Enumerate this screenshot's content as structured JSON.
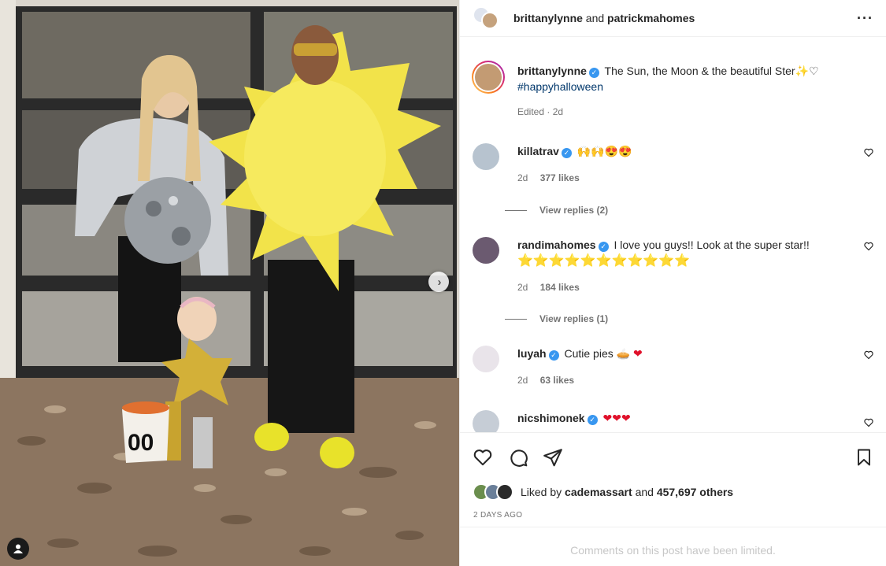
{
  "header": {
    "user1": "brittanylynne",
    "joiner": "and",
    "user2": "patrickmahomes",
    "more_icon": "more-horizontal-icon"
  },
  "caption": {
    "username": "brittanylynne",
    "text": "The Sun, the Moon & the beautiful Ster",
    "emoji": "✨♡",
    "hashtag": "#happyhalloween",
    "meta": "Edited · 2d"
  },
  "comments": [
    {
      "username": "killatrav",
      "text": "",
      "emoji": "🙌🙌😍😍",
      "time": "2d",
      "likes": "377 likes",
      "replies": "View replies (2)"
    },
    {
      "username": "randimahomes",
      "text": "I love you guys!! Look at the super star!!",
      "emoji": "⭐⭐⭐⭐⭐⭐⭐⭐⭐⭐⭐",
      "time": "2d",
      "likes": "184 likes",
      "replies": "View replies (1)"
    },
    {
      "username": "luyah",
      "text": "Cutie pies",
      "emoji": "🥧 ❤",
      "time": "2d",
      "likes": "63 likes"
    },
    {
      "username": "nicshimonek",
      "text": "",
      "emoji": "❤❤❤"
    }
  ],
  "likes": {
    "prefix": "Liked by",
    "user": "cademassart",
    "joiner": "and",
    "count": "457,697 others"
  },
  "date": "2 DAYS AGO",
  "limited": "Comments on this post have been limited.",
  "colors": {
    "verified": "#3897f0",
    "hashtag": "#00376b",
    "muted": "#737373",
    "border": "#efefef"
  }
}
